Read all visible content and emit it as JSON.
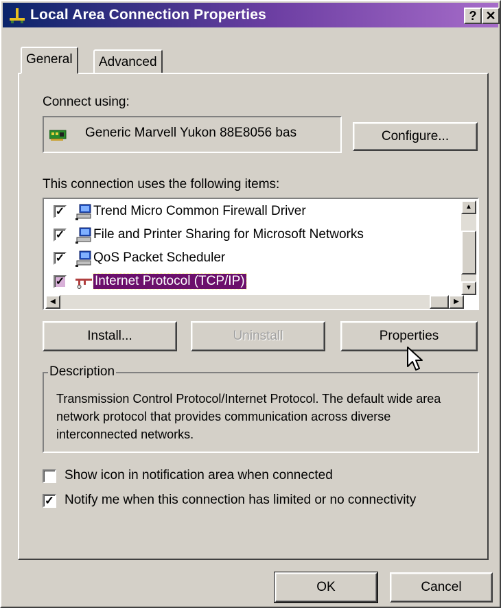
{
  "window": {
    "title": "Local Area Connection Properties",
    "help_glyph": "?",
    "close_glyph": "✕"
  },
  "tabs": [
    {
      "label": "General"
    },
    {
      "label": "Advanced"
    }
  ],
  "connect_using": {
    "label": "Connect using:",
    "adapter": "Generic Marvell Yukon 88E8056 bas",
    "configure_label": "Configure..."
  },
  "items_label": "This connection uses the following items:",
  "items": [
    {
      "label": "Trend Micro Common Firewall Driver",
      "checked": true,
      "icon": "network-client-icon"
    },
    {
      "label": "File and Printer Sharing for Microsoft Networks",
      "checked": true,
      "icon": "network-client-icon"
    },
    {
      "label": "QoS Packet Scheduler",
      "checked": true,
      "icon": "network-client-icon"
    },
    {
      "label": "Internet Protocol (TCP/IP)",
      "checked": true,
      "icon": "protocol-icon",
      "selected": true
    }
  ],
  "buttons": {
    "install": "Install...",
    "uninstall": "Uninstall",
    "properties": "Properties",
    "ok": "OK",
    "cancel": "Cancel"
  },
  "description": {
    "label": "Description",
    "text": "Transmission Control Protocol/Internet Protocol. The default wide area network protocol that provides communication across diverse interconnected networks."
  },
  "options": [
    {
      "label": "Show icon in notification area when connected",
      "checked": false
    },
    {
      "label": "Notify me when this connection has limited or no connectivity",
      "checked": true
    }
  ],
  "check_glyph": "✓",
  "colors": {
    "title_start": "#0a246a",
    "title_end": "#a66cc9",
    "selection": "#6b0f6b",
    "face": "#d4d0c8"
  }
}
